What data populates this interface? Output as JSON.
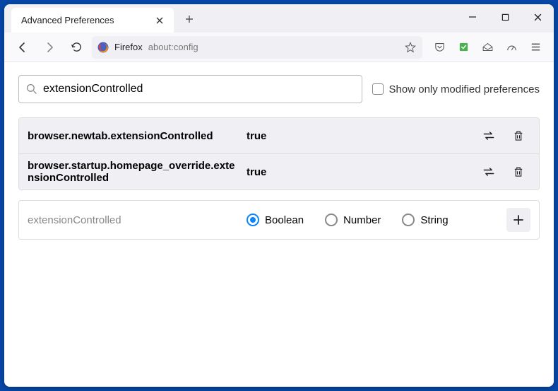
{
  "tab": {
    "title": "Advanced Preferences"
  },
  "toolbar": {
    "identity_label": "Firefox",
    "url": "about:config"
  },
  "search": {
    "value": "extensionControlled",
    "show_modified_label": "Show only modified preferences"
  },
  "prefs": [
    {
      "name": "browser.newtab.extensionControlled",
      "value": "true"
    },
    {
      "name": "browser.startup.homepage_override.extensionControlled",
      "value": "true"
    }
  ],
  "newpref": {
    "name": "extensionControlled",
    "types": {
      "boolean": "Boolean",
      "number": "Number",
      "string": "String"
    }
  }
}
